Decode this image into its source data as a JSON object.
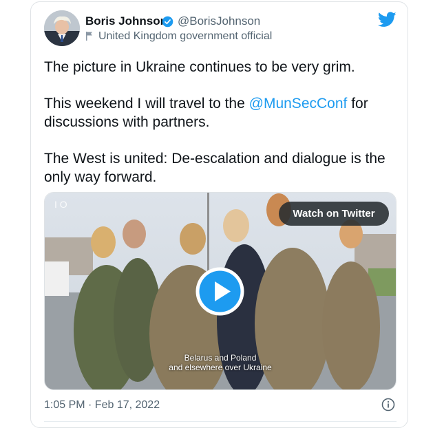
{
  "author": {
    "name": "Boris Johnson",
    "handle": "@BorisJohnson",
    "affiliation": "United Kingdom government official",
    "avatar_icon": "avatar-photo",
    "verified_icon": "verified-badge-icon",
    "flag_icon": "flag-icon"
  },
  "brand": {
    "logo_icon": "twitter-bird-icon",
    "accent": "#1d9bf0"
  },
  "tweet": {
    "line1": "The picture in Ukraine continues to be very grim.",
    "line2_before": "This weekend I will travel to the ",
    "mention": "@MunSecConf",
    "line2_after": " for discussions with partners.",
    "line3": "The West is united: De-escalation and dialogue is the only way forward."
  },
  "media": {
    "watch_label": "Watch on Twitter",
    "caption_line1": "Belarus and Poland",
    "caption_line2": "and elsewhere over Ukraine",
    "corner_mark": "I O",
    "play_icon": "play-icon"
  },
  "footer": {
    "timestamp": "1:05 PM · Feb 17, 2022",
    "info_icon": "info-icon"
  },
  "colors": {
    "text": "#0f1419",
    "secondary": "#536471",
    "border": "#dfe3e6"
  }
}
